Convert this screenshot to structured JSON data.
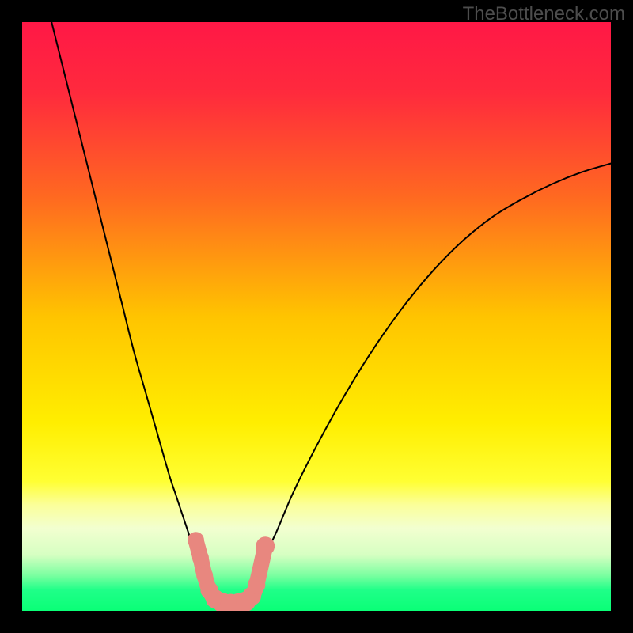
{
  "watermark": "TheBottleneck.com",
  "chart_data": {
    "type": "line",
    "title": "",
    "xlabel": "",
    "ylabel": "",
    "xlim": [
      0,
      100
    ],
    "ylim": [
      0,
      100
    ],
    "gradient_stops": [
      {
        "offset": 0.0,
        "color": "#ff1846"
      },
      {
        "offset": 0.12,
        "color": "#ff2a3d"
      },
      {
        "offset": 0.3,
        "color": "#ff6a20"
      },
      {
        "offset": 0.5,
        "color": "#ffc400"
      },
      {
        "offset": 0.68,
        "color": "#ffee00"
      },
      {
        "offset": 0.78,
        "color": "#ffff33"
      },
      {
        "offset": 0.82,
        "color": "#fbff9a"
      },
      {
        "offset": 0.86,
        "color": "#f2ffd0"
      },
      {
        "offset": 0.905,
        "color": "#d6ffc2"
      },
      {
        "offset": 0.94,
        "color": "#7affa0"
      },
      {
        "offset": 0.965,
        "color": "#1fff88"
      },
      {
        "offset": 1.0,
        "color": "#0aff77"
      }
    ],
    "series": [
      {
        "name": "left-curve",
        "x": [
          5,
          7,
          9,
          11,
          13,
          15,
          17,
          19,
          21,
          23,
          25,
          26,
          27,
          28,
          29,
          30,
          31,
          32
        ],
        "y": [
          100,
          92,
          84,
          76,
          68,
          60,
          52,
          44,
          37,
          30,
          23,
          20,
          17,
          14,
          11,
          8,
          5,
          3
        ]
      },
      {
        "name": "right-curve",
        "x": [
          38,
          40,
          43,
          46,
          50,
          55,
          60,
          65,
          70,
          75,
          80,
          85,
          90,
          95,
          100
        ],
        "y": [
          3,
          7,
          13,
          20,
          28,
          37,
          45,
          52,
          58,
          63,
          67,
          70,
          72.5,
          74.5,
          76
        ]
      }
    ],
    "markers": {
      "name": "bottom-markers",
      "points": [
        {
          "x": 29.5,
          "y": 12,
          "r": 1.5
        },
        {
          "x": 30.3,
          "y": 9,
          "r": 1.5
        },
        {
          "x": 31.0,
          "y": 6,
          "r": 1.5
        },
        {
          "x": 31.8,
          "y": 3.5,
          "r": 1.6
        },
        {
          "x": 32.8,
          "y": 2.0,
          "r": 1.7
        },
        {
          "x": 34.0,
          "y": 1.4,
          "r": 1.8
        },
        {
          "x": 35.4,
          "y": 1.2,
          "r": 1.8
        },
        {
          "x": 36.8,
          "y": 1.3,
          "r": 1.8
        },
        {
          "x": 38.0,
          "y": 1.6,
          "r": 1.8
        },
        {
          "x": 39.0,
          "y": 2.5,
          "r": 1.7
        },
        {
          "x": 39.8,
          "y": 4.4,
          "r": 1.6
        },
        {
          "x": 41.3,
          "y": 11.0,
          "r": 1.7
        }
      ],
      "color": "#e8877f"
    }
  }
}
